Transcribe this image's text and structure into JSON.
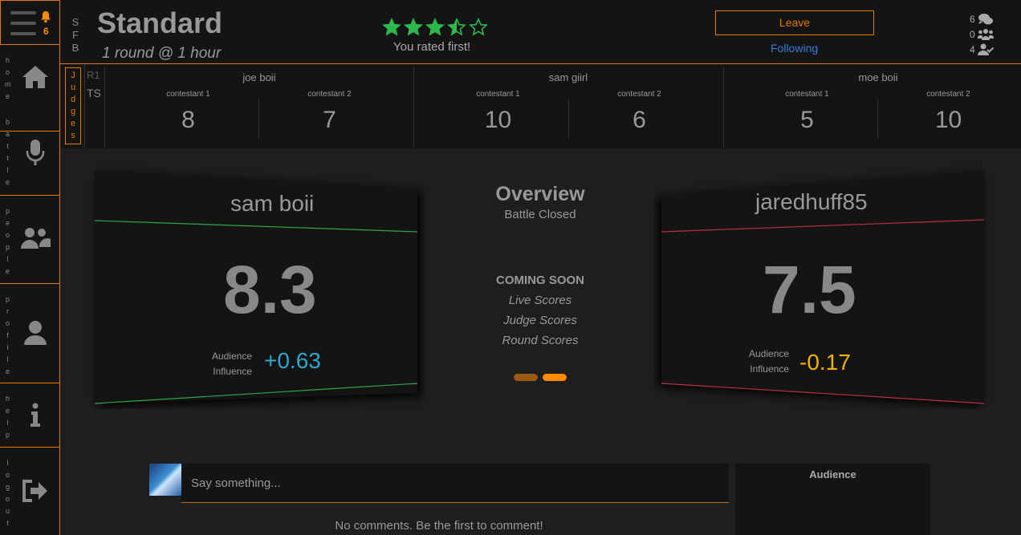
{
  "sidebar": {
    "notification_count": "6",
    "items": [
      {
        "label": "home",
        "icon": "home-icon"
      },
      {
        "label": "battle",
        "icon": "microphone-icon"
      },
      {
        "label": "people",
        "icon": "users-icon"
      },
      {
        "label": "profile",
        "icon": "user-icon"
      },
      {
        "label": "help",
        "icon": "info-icon"
      },
      {
        "label": "logout",
        "icon": "sign-out-icon"
      }
    ]
  },
  "header": {
    "sfb": "SFB",
    "title": "Standard",
    "subtitle": "1 round @ 1 hour",
    "rating": 3.5,
    "rating_max": 5,
    "rated_text": "You rated first!",
    "leave_label": "Leave",
    "following_label": "Following",
    "counts": [
      {
        "value": "6",
        "icon": "comments-icon"
      },
      {
        "value": "0",
        "icon": "users-icon"
      },
      {
        "value": "4",
        "icon": "user-check-icon"
      }
    ]
  },
  "judges": {
    "label": "Judges",
    "round": "R1",
    "category": "TS",
    "list": [
      {
        "name": "joe boii",
        "c1_label": "contestant 1",
        "c1": "8",
        "c2_label": "contestant 2",
        "c2": "7"
      },
      {
        "name": "sam giirl",
        "c1_label": "contestant 1",
        "c1": "10",
        "c2_label": "contestant 2",
        "c2": "6"
      },
      {
        "name": "moe boii",
        "c1_label": "contestant 1",
        "c1": "5",
        "c2_label": "contestant 2",
        "c2": "10"
      }
    ]
  },
  "contestants": {
    "left": {
      "name": "sam boii",
      "score": "8.3",
      "influence_label_1": "Audience",
      "influence_label_2": "Influence",
      "influence": "+0.63",
      "influence_color": "#2aa9c9",
      "line_color": "#2ea84a"
    },
    "right": {
      "name": "jaredhuff85",
      "score": "7.5",
      "influence_label_1": "Audience",
      "influence_label_2": "Influence",
      "influence": "-0.17",
      "influence_color": "#f0b400",
      "line_color": "#c0303a"
    }
  },
  "overview": {
    "title": "Overview",
    "status": "Battle Closed",
    "coming_soon": "COMING SOON",
    "items": [
      "Live Scores",
      "Judge Scores",
      "Round Scores"
    ]
  },
  "comments": {
    "placeholder": "Say something...",
    "empty_text": "No comments. Be the first to comment!",
    "audience_title": "Audience"
  },
  "colors": {
    "accent": "#e07b00",
    "star": "#2db84d",
    "dot_1": "#9a5a10",
    "dot_2": "#ff8c00"
  }
}
